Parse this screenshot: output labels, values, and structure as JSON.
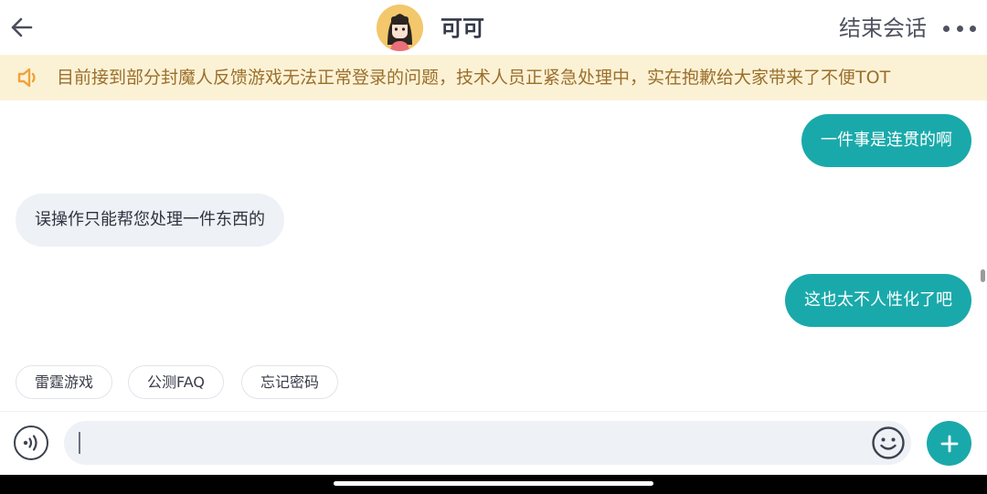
{
  "header": {
    "title": "可可",
    "end_chat_label": "结束会话",
    "back_icon": "back-arrow-icon",
    "more_icon": "more-dots-icon"
  },
  "notice": {
    "icon": "speaker-icon",
    "text": "目前接到部分封魔人反馈游戏无法正常登录的问题，技术人员正紧急处理中，实在抱歉给大家带来了不便TOT"
  },
  "messages": [
    {
      "side": "out",
      "text": "一件事是连贯的啊"
    },
    {
      "side": "in",
      "text": "误操作只能帮您处理一件东西的"
    },
    {
      "side": "out",
      "text": "这也太不人性化了吧"
    }
  ],
  "quick_replies": [
    "雷霆游戏",
    "公测FAQ",
    "忘记密码"
  ],
  "input": {
    "value": "",
    "placeholder": ""
  },
  "colors": {
    "accent": "#1aa9aa",
    "notice_bg": "#fbf2d6",
    "notice_text": "#9b6f2b",
    "incoming_bubble": "#eef1f5"
  }
}
